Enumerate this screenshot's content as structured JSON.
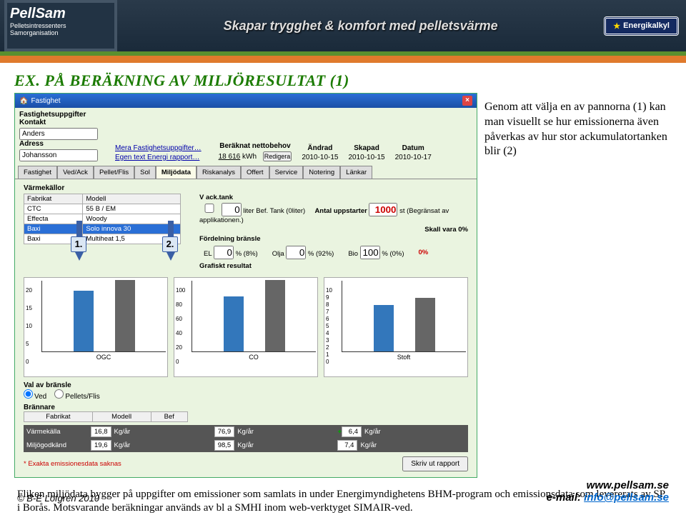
{
  "banner": {
    "brand": "PellSam",
    "sub1": "Pelletsintressenters",
    "sub2": "Samorganisation",
    "tagline": "Skapar trygghet & komfort med pelletsvärme",
    "energikalkyl": "Energikalkyl"
  },
  "title": "EX. PÅ BERÄKNING AV MILJÖRESULTAT (1)",
  "sidetext": "Genom att välja en av pannorna (1) kan man visuellt se hur emissionerna även påverkas av hur stor ackumulatortanken blir (2)",
  "annotations": {
    "a1": "1.",
    "a2": "2."
  },
  "app": {
    "title": "Fastighet",
    "fields": {
      "kontakt_label": "Kontakt",
      "kontakt": "Anders",
      "adress_label": "Adress",
      "adress": "Johansson",
      "link1": "Mera Fastighetsuppgifter…",
      "link2": "Egen text Energi rapport…",
      "fastighets_label": "Fastighetsuppgifter",
      "net_label": "Beräknat nettobehov",
      "net_val": "18 616",
      "net_unit": "kWh",
      "redigera": "Redigera",
      "andrad_h": "Ändrad",
      "andrad": "2010-10-15",
      "skapad_h": "Skapad",
      "skapad": "2010-10-15",
      "datum_h": "Datum",
      "datum": "2010-10-17"
    },
    "tabs": [
      "Fastighet",
      "Ved/Ack",
      "Pellet/Flis",
      "Sol",
      "Miljödata",
      "Riskanalys",
      "Offert",
      "Service",
      "Notering",
      "Länkar"
    ],
    "active_tab": "Miljödata",
    "varmekallor_label": "Värmekällor",
    "table1": {
      "head": [
        "Fabrikat",
        "Modell"
      ],
      "rows": [
        [
          "CTC",
          "55 B / EM"
        ],
        [
          "Effecta",
          "Woody"
        ],
        [
          "Baxi",
          "Solo innova 30"
        ],
        [
          "Baxi",
          "Multiheat 1,5"
        ]
      ],
      "selected_index": 2
    },
    "ack": {
      "label": "V ack.tank",
      "vol_input": "0",
      "vol_unit": "liter Bef. Tank (0liter)",
      "uppstart_label": "Antal uppstarter",
      "uppstart_val": "1000",
      "uppstart_note": "st (Begränsat av applikationen.)",
      "skallnote": "Skall vara 0%",
      "fordel_label": "Fördelning bränsle",
      "el_label": "EL",
      "el_val": "0",
      "el_pct": "% (8%)",
      "olja_label": "Olja",
      "olja_val": "0",
      "olja_pct": "% (92%)",
      "bio_label": "Bio",
      "bio_val": "100",
      "bio_pct": "% (0%)",
      "rest_pct": "0%",
      "grafisk_label": "Grafiskt resultat"
    },
    "valbransle": {
      "label": "Val av bränsle",
      "opt1": "Ved",
      "opt2": "Pellets/Flis"
    },
    "brannare": {
      "label": "Brännare",
      "head": [
        "Fabrikat",
        "Modell",
        "Bef"
      ]
    },
    "em_rows": [
      {
        "name": "Värmekälla",
        "a": "16,8",
        "b": "76,9",
        "c": "6,4",
        "u": "Kg/år",
        "plus": true
      },
      {
        "name": "Miljögodkänd",
        "a": "19,6",
        "b": "98,5",
        "c": "7,4",
        "u": "Kg/år",
        "plus": false
      }
    ],
    "warn": "* Exakta emissionesdata saknas",
    "rapport_btn": "Skriv ut rapport"
  },
  "chart_data": [
    {
      "type": "bar",
      "ylim": [
        0,
        20
      ],
      "yticks": [
        0,
        5,
        10,
        15,
        20
      ],
      "categories": [
        "OGC"
      ],
      "series": [
        {
          "name": "cur",
          "values": [
            17
          ],
          "color": "#37b"
        },
        {
          "name": "ref",
          "values": [
            20
          ],
          "color": "#666"
        }
      ]
    },
    {
      "type": "bar",
      "ylim": [
        0,
        100
      ],
      "yticks": [
        0,
        20,
        40,
        60,
        80,
        100
      ],
      "categories": [
        "CO"
      ],
      "series": [
        {
          "name": "cur",
          "values": [
            77
          ],
          "color": "#37b"
        },
        {
          "name": "ref",
          "values": [
            100
          ],
          "color": "#666"
        }
      ]
    },
    {
      "type": "bar",
      "ylim": [
        0,
        10
      ],
      "yticks": [
        0,
        1,
        2,
        3,
        4,
        5,
        6,
        7,
        8,
        9,
        10
      ],
      "categories": [
        "Stoft"
      ],
      "series": [
        {
          "name": "cur",
          "values": [
            6.5
          ],
          "color": "#37b"
        },
        {
          "name": "ref",
          "values": [
            7.5
          ],
          "color": "#666"
        }
      ]
    }
  ],
  "bottomtext": "Fliken miljödata bygger på uppgifter om emissioner som samlats in under Energimyndighetens BHM-program och emissionsdata som levererats av SP i Borås. Motsvarande beräkningar används av bl a SMHI inom web-verktyget SIMAIR-ved.",
  "footer": {
    "copy": "© B-E Löfgren 2010",
    "site": "www.pellsam.se",
    "mail_label": "e-mail: ",
    "mail": "info@pellsam.se"
  }
}
